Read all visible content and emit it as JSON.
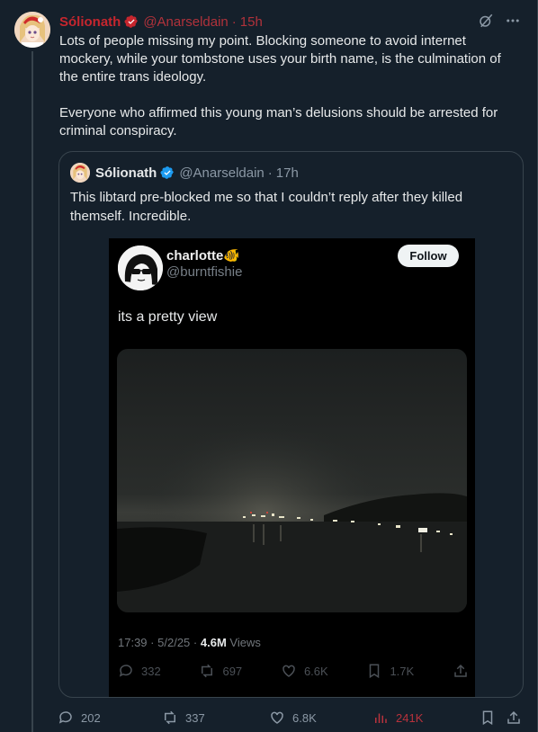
{
  "tweet": {
    "author_name": "Sólionath",
    "author_handle": "@Anarseldain",
    "separator": "·",
    "time": "15h",
    "text_p1": "Lots of people missing my point. Blocking someone to avoid internet mockery, while your tombstone uses your birth name, is the culmination of the entire trans ideology.",
    "text_p2": "Everyone who affirmed this young man’s delusions should be arrested for criminal conspiracy.",
    "icons": [
      "grok-icon",
      "more-icon"
    ],
    "colors": {
      "author_name": "#c6262e",
      "author_handle": "#b1323b",
      "views": "#b8323c"
    }
  },
  "quote": {
    "author_name": "Sólionath",
    "author_handle": "@Anarseldain",
    "separator": "·",
    "time": "17h",
    "text": "This libtard pre-blocked me so that I couldn’t reply after they killed themself. Incredible."
  },
  "embed": {
    "author_name": "charlotte",
    "author_emoji": "🐠",
    "author_handle": "@burntfishie",
    "follow_label": "Follow",
    "text": "its a pretty view",
    "time": "17:39",
    "dot": "·",
    "date": "5/2/25",
    "dot2": "·",
    "views_count": "4.6M",
    "views_label": "Views",
    "replies": "332",
    "reposts": "697",
    "likes": "6.6K",
    "bookmarks": "1.7K"
  },
  "actions": {
    "replies": "202",
    "reposts": "337",
    "likes": "6.8K",
    "views": "241K"
  }
}
